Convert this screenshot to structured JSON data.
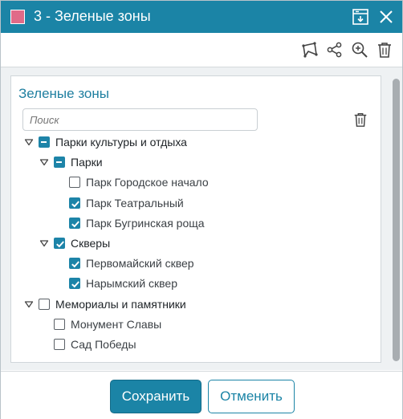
{
  "window": {
    "title": "3 - Зеленые зоны",
    "swatch_color": "#e06b88",
    "accent_color": "#1b84a6"
  },
  "titlebar_icons": [
    "dock-window-icon",
    "close-icon"
  ],
  "toolbar": {
    "icons": [
      "polygon-select-icon",
      "share-icon",
      "zoom-in-icon",
      "trash-icon"
    ]
  },
  "panel": {
    "title": "Зеленые зоны",
    "search_placeholder": "Поиск"
  },
  "tree": [
    {
      "label": "Парки культуры и отдыха",
      "state": "partial",
      "level": 0,
      "expandable": true,
      "bold": true
    },
    {
      "label": "Парки",
      "state": "partial",
      "level": 1,
      "expandable": true,
      "bold": true
    },
    {
      "label": "Парк Городское начало",
      "state": "unchecked",
      "level": 2,
      "expandable": false,
      "bold": false
    },
    {
      "label": "Парк Театральный",
      "state": "checked",
      "level": 2,
      "expandable": false,
      "bold": false
    },
    {
      "label": "Парк Бугринская роща",
      "state": "checked",
      "level": 2,
      "expandable": false,
      "bold": false
    },
    {
      "label": "Скверы",
      "state": "checked",
      "level": 1,
      "expandable": true,
      "bold": true
    },
    {
      "label": "Первомайский сквер",
      "state": "checked",
      "level": 2,
      "expandable": false,
      "bold": false
    },
    {
      "label": "Нарымский сквер",
      "state": "checked",
      "level": 2,
      "expandable": false,
      "bold": false
    },
    {
      "label": "Мемориалы и памятники",
      "state": "unchecked",
      "level": 0,
      "expandable": true,
      "bold": true
    },
    {
      "label": "Монумент Славы",
      "state": "unchecked",
      "level": 1,
      "expandable": false,
      "bold": false
    },
    {
      "label": "Сад Победы",
      "state": "unchecked",
      "level": 1,
      "expandable": false,
      "bold": false
    }
  ],
  "footer": {
    "save_label": "Сохранить",
    "cancel_label": "Отменить"
  }
}
